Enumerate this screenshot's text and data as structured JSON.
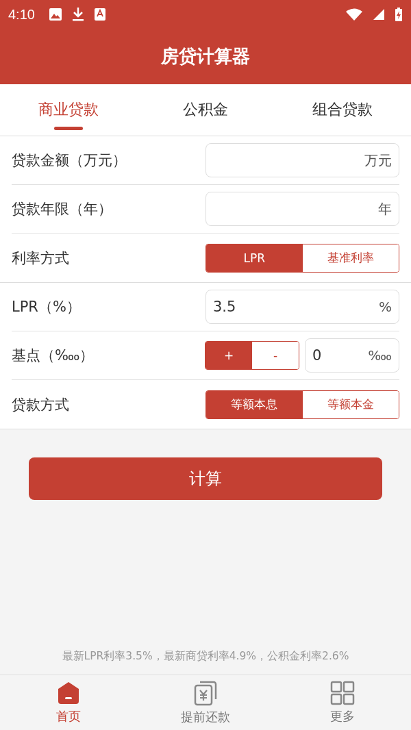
{
  "status_bar": {
    "time": "4:10"
  },
  "title": "房贷计算器",
  "tabs": [
    {
      "label": "商业贷款",
      "selected": true
    },
    {
      "label": "公积金",
      "selected": false
    },
    {
      "label": "组合贷款",
      "selected": false
    }
  ],
  "sections": [
    [
      {
        "kind": "input",
        "label": "贷款金额（万元）",
        "unit": "万元"
      },
      {
        "kind": "input",
        "label": "贷款年限（年）",
        "unit": "年"
      },
      {
        "kind": "toggle",
        "label": "利率方式",
        "options": [
          {
            "label": "LPR",
            "selected": true
          },
          {
            "label": "基准利率",
            "selected": false
          }
        ]
      }
    ],
    [
      {
        "kind": "input",
        "label": "LPR（%）",
        "value": "3.5",
        "unit": "%"
      },
      {
        "kind": "stepper",
        "label": "基点（‱）",
        "options": [
          {
            "label": "+",
            "selected": true
          },
          {
            "label": "-",
            "selected": false
          }
        ],
        "value": "0",
        "unit": "‱"
      },
      {
        "kind": "toggle",
        "label": "贷款方式",
        "options": [
          {
            "label": "等额本息",
            "selected": true
          },
          {
            "label": "等额本金",
            "selected": false
          }
        ]
      }
    ]
  ],
  "calculate_button": "计算",
  "note": "最新LPR利率3.5%，最新商贷利率4.9%，公积金利率2.6%",
  "nav": [
    {
      "label": "首页",
      "selected": true,
      "kind": "home"
    },
    {
      "label": "提前还款",
      "selected": false,
      "kind": "money"
    },
    {
      "label": "更多",
      "selected": false,
      "kind": "grid"
    }
  ]
}
